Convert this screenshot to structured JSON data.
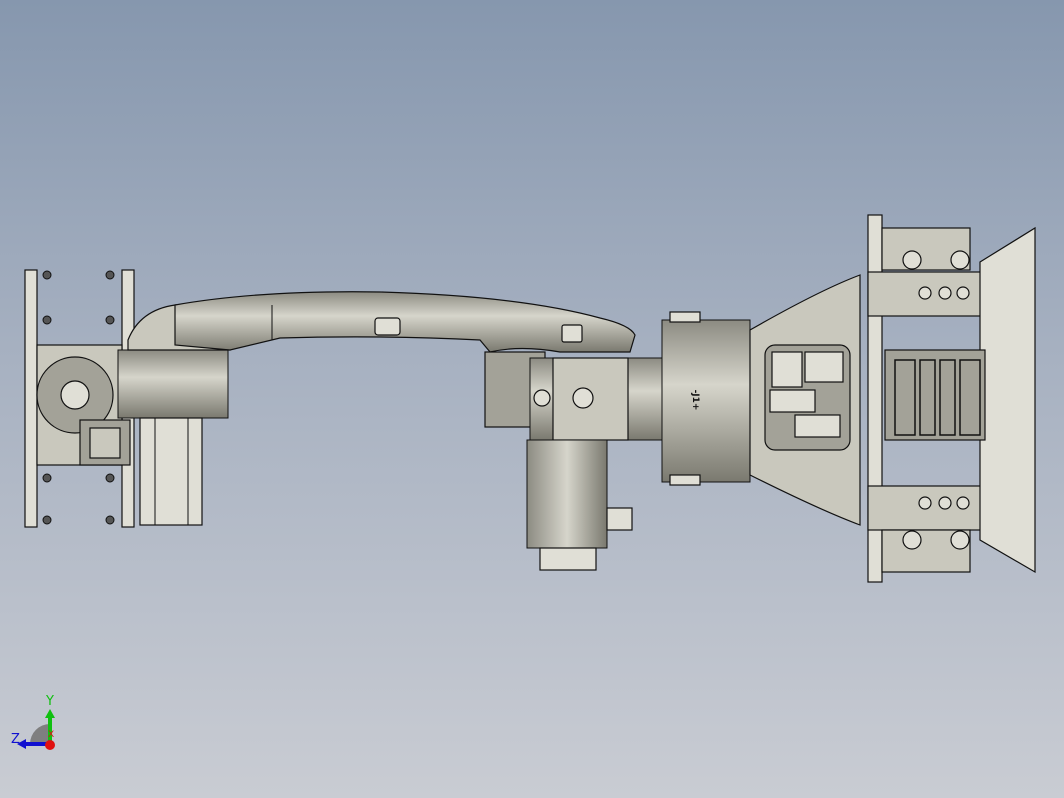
{
  "model": {
    "joint_label": "-J1+"
  },
  "triad": {
    "x_label": "X",
    "y_label": "Y",
    "z_label": "Z"
  },
  "colors": {
    "body": "#c9c8bd",
    "shade": "#a3a298",
    "x_axis": "#e01010",
    "y_axis": "#10c010",
    "z_axis": "#1010d0"
  }
}
